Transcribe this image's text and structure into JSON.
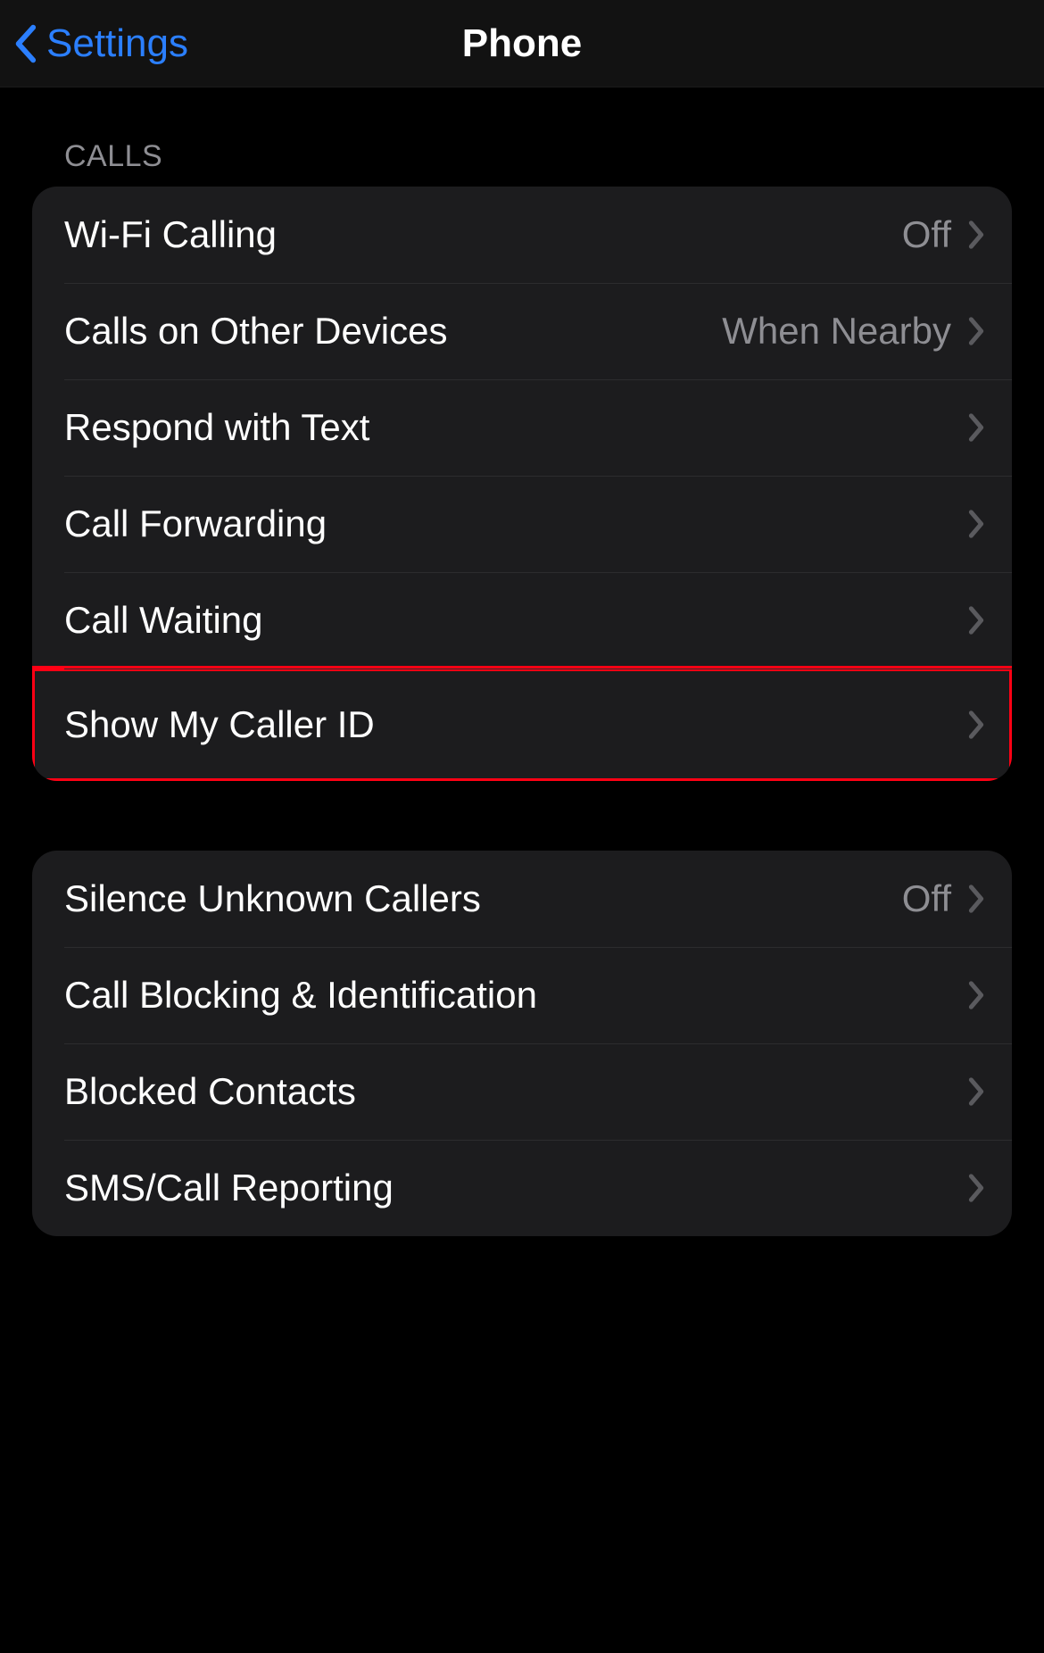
{
  "nav": {
    "back_label": "Settings",
    "title": "Phone"
  },
  "sections": {
    "calls": {
      "header": "CALLS",
      "items": [
        {
          "label": "Wi-Fi Calling",
          "value": "Off"
        },
        {
          "label": "Calls on Other Devices",
          "value": "When Nearby"
        },
        {
          "label": "Respond with Text",
          "value": ""
        },
        {
          "label": "Call Forwarding",
          "value": ""
        },
        {
          "label": "Call Waiting",
          "value": ""
        },
        {
          "label": "Show My Caller ID",
          "value": ""
        }
      ]
    },
    "group2": {
      "items": [
        {
          "label": "Silence Unknown Callers",
          "value": "Off"
        },
        {
          "label": "Call Blocking & Identification",
          "value": ""
        },
        {
          "label": "Blocked Contacts",
          "value": ""
        },
        {
          "label": "SMS/Call Reporting",
          "value": ""
        }
      ]
    }
  }
}
